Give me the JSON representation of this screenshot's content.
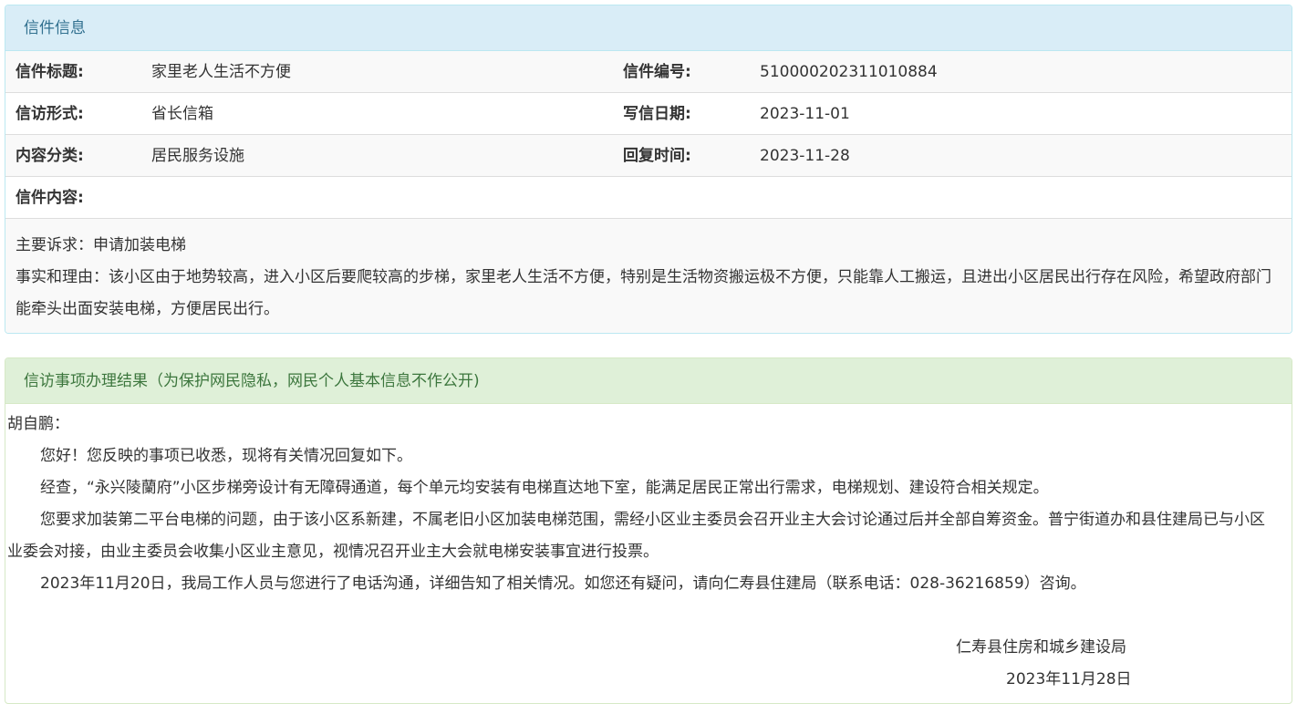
{
  "letter_info": {
    "heading": "信件信息",
    "title_label": "信件标题:",
    "title_value": "家里老人生活不方便",
    "number_label": "信件编号:",
    "number_value": "510000202311010884",
    "form_label": "信访形式:",
    "form_value": "省长信箱",
    "date_label": "写信日期:",
    "date_value": "2023-11-01",
    "category_label": "内容分类:",
    "category_value": "居民服务设施",
    "reply_time_label": "回复时间:",
    "reply_time_value": "2023-11-28",
    "content_label": "信件内容:",
    "content_lines": [
      "主要诉求：申请加装电梯",
      "事实和理由：该小区由于地势较高，进入小区后要爬较高的步梯，家里老人生活不方便，特别是生活物资搬运极不方便，只能靠人工搬运，且进出小区居民出行存在风险，希望政府部门能牵头出面安装电梯，方便居民出行。"
    ]
  },
  "result": {
    "heading": "信访事项办理结果（为保护网民隐私，网民个人基本信息不作公开)",
    "salutation": "胡自鹏：",
    "paragraphs": [
      "您好！您反映的事项已收悉，现将有关情况回复如下。",
      "经查，“永兴陵蘭府”小区步梯旁设计有无障碍通道，每个单元均安装有电梯直达地下室，能满足居民正常出行需求，电梯规划、建设符合相关规定。",
      "您要求加装第二平台电梯的问题，由于该小区系新建，不属老旧小区加装电梯范围，需经小区业主委员会召开业主大会讨论通过后并全部自筹资金。普宁街道办和县住建局已与小区业委会对接，由业主委员会收集小区业主意见，视情况召开业主大会就电梯安装事宜进行投票。",
      "2023年11月20日，我局工作人员与您进行了电话沟通，详细告知了相关情况。如您还有疑问，请向仁寿县住建局（联系电话：028-36216859）咨询。"
    ],
    "signature_org": "仁寿县住房和城乡建设局",
    "signature_date": "2023年11月28日"
  }
}
